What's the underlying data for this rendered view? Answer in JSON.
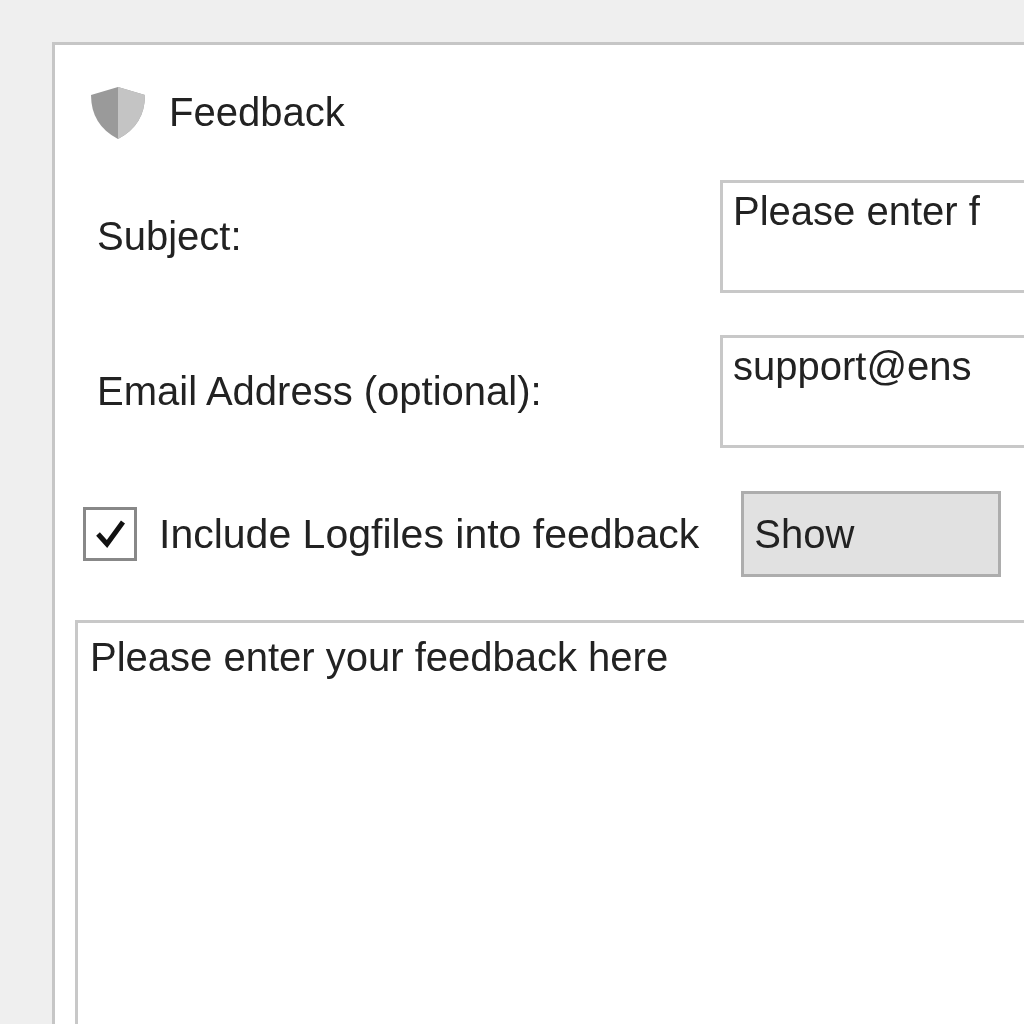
{
  "window": {
    "title": "Feedback"
  },
  "fields": [
    {
      "label": "Subject:",
      "value": "Please enter f"
    },
    {
      "label": "Email Address (optional):",
      "value": "support@ens"
    }
  ],
  "logfiles": {
    "label": "Include Logfiles into feedback",
    "checked": true
  },
  "show_button": {
    "label": "Show"
  },
  "feedback": {
    "value": "Please enter your feedback here"
  }
}
